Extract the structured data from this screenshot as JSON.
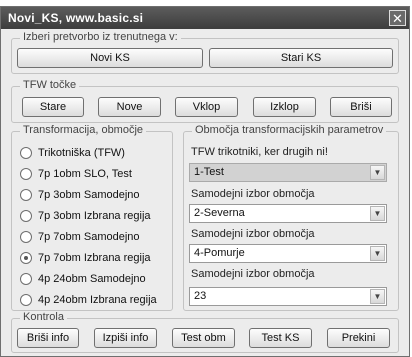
{
  "window": {
    "title": "Novi_KS, www.basic.si",
    "close_glyph": "✕"
  },
  "group_select": {
    "legend": "Izberi pretvorbo iz trenutnega v:",
    "buttons": [
      "Novi KS",
      "Stari KS"
    ]
  },
  "group_tfw": {
    "legend": "TFW točke",
    "buttons": [
      "Stare",
      "Nove",
      "Vklop",
      "Izklop",
      "Briši"
    ]
  },
  "group_transform": {
    "legend": "Transformacija, območje",
    "options": [
      {
        "label": "Trikotniška (TFW)",
        "selected": false
      },
      {
        "label": "7p  1obm SLO, Test",
        "selected": false
      },
      {
        "label": "7p  3obm Samodejno",
        "selected": false
      },
      {
        "label": "7p  3obm Izbrana regija",
        "selected": false
      },
      {
        "label": "7p  7obm Samodejno",
        "selected": false
      },
      {
        "label": "7p  7obm Izbrana regija",
        "selected": true
      },
      {
        "label": "4p  24obm Samodejno",
        "selected": false
      },
      {
        "label": "4p  24obm Izbrana regija",
        "selected": false
      }
    ]
  },
  "group_params": {
    "legend": "Območja transformacijskih parametrov",
    "fields": [
      {
        "label": "TFW trikotniki, ker drugih ni!",
        "value": "1-Test",
        "disabled": true
      },
      {
        "label": "Samodejni izbor območja",
        "value": "2-Severna",
        "disabled": false
      },
      {
        "label": "Samodejni izbor območja",
        "value": "4-Pomurje",
        "disabled": false
      },
      {
        "label": "Samodejni izbor območja",
        "value": "23",
        "disabled": false
      }
    ],
    "arrow_glyph": "▼"
  },
  "group_control": {
    "legend": "Kontrola",
    "buttons": [
      "Briši info",
      "Izpiši info",
      "Test obm",
      "Test KS",
      "Prekini"
    ]
  }
}
